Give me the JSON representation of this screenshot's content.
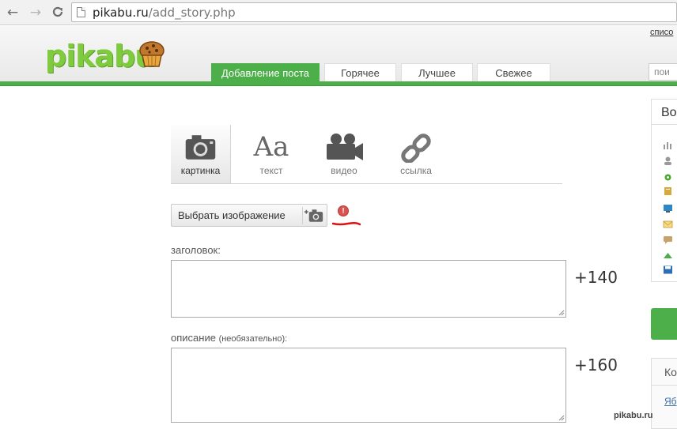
{
  "browser": {
    "url_host": "pikabu.ru",
    "url_path": "/add_story.php",
    "back_glyph": "←",
    "forward_glyph": "→",
    "reload_glyph": "C"
  },
  "header": {
    "logo_text": "pikabu",
    "top_link": "списо",
    "search_placeholder": "пои",
    "tabs": [
      {
        "label": "Добавление поста",
        "active": true
      },
      {
        "label": "Горячее",
        "active": false
      },
      {
        "label": "Лучшее",
        "active": false
      },
      {
        "label": "Свежее",
        "active": false
      }
    ]
  },
  "post_types": [
    {
      "label": "картинка",
      "icon": "camera-icon",
      "active": true
    },
    {
      "label": "текст",
      "icon": "text-aa-icon",
      "active": false
    },
    {
      "label": "видео",
      "icon": "video-camera-icon",
      "active": false
    },
    {
      "label": "ссылка",
      "icon": "link-icon",
      "active": false
    }
  ],
  "text_icon_glyph": "Aa",
  "choose_image_label": "Выбрать изображение",
  "warning_glyph": "!",
  "fields": {
    "title_label": "заголовок:",
    "title_value": "",
    "title_counter": "+140",
    "desc_label": "описание",
    "desc_optional": "(необязательно):",
    "desc_value": "",
    "desc_counter": "+160"
  },
  "sidebar": {
    "box1_heading": "Во",
    "box2_heading": "Ко",
    "box2_link": "Яб",
    "icons": [
      "chart-icon",
      "user-icon",
      "gear-icon",
      "book-icon",
      "monitor-icon",
      "mail-icon",
      "comment-icon",
      "arrow-up-icon",
      "save-icon"
    ]
  },
  "watermark": "pikabu.ru"
}
